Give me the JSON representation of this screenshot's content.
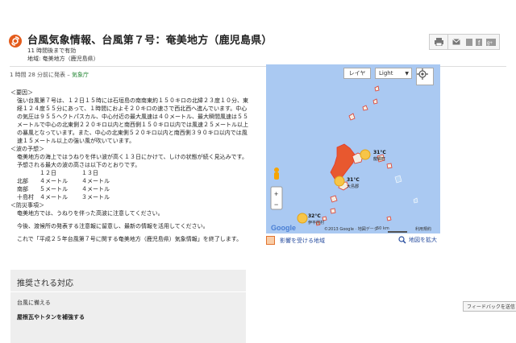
{
  "header": {
    "title": "台風気象情報、台風第７号：奄美地方（鹿児島県）",
    "valid": "11 時間後まで有効",
    "region": "地域: 奄美地方（鹿児島県）"
  },
  "posted": {
    "time": "1 時間 28 分前に発表 – ",
    "source": "気象庁"
  },
  "body": {
    "s1_head": "＜要因＞",
    "s1_text": "強い台風第７号は、１２日１５時には石垣島の南南東約１５０キロの北緯２３度１０分、東経１２４度５５分にあって、１時間におよそ２０キロの速さで西北西へ進んでいます。中心の気圧は９５５ヘクトパスカル、中心付近の最大風速は４０メートル、最大瞬間風速は５５メートルで中心の北東側２２０キロ以内と南西側１５０キロ以内では風速２５メートル以上の暴風となっています。また、中心の北東側５２０キロ以内と南西側３９０キロ以内では風速１５メートル以上の強い風が吹いています。",
    "s2_head": "＜波の予想＞",
    "s2_text": "奄美地方の海上ではうねりを伴い波が高く１３日にかけて、しけの状態が続く見込みです。予想される最大の波の高さは以下のとおりです。",
    "wave_rows": [
      [
        "",
        "１２日",
        "１３日"
      ],
      [
        "北部",
        "４メートル",
        "４メートル"
      ],
      [
        "南部",
        "５メートル",
        "４メートル"
      ],
      [
        "十島村",
        "４メートル",
        "３メートル"
      ]
    ],
    "s3_head": "＜防災事項＞",
    "s3_text": "奄美地方では、うねりを伴った高波に注意してください。",
    "s4_text": "今後、渡候所の発表する注意報に留意し、最新の情報を活用してください。",
    "s5_text": "これで「平成２５年台風第７号に関する奄美地方（鹿児島県）気象情報」を終了します。"
  },
  "recommend": {
    "title": "推奨される対応",
    "t1": "台風に備える",
    "t2": "屋根瓦やトタンを補強する"
  },
  "map": {
    "layer_btn": "レイヤ",
    "layer_select": "Light",
    "labels": [
      {
        "temp": "31°C",
        "place": "龍郷町"
      },
      {
        "temp": "31°C",
        "place": "大島郡"
      },
      {
        "temp": "32°C",
        "place": "伊平屋村"
      }
    ],
    "copyright": "©2013 Google · 地図データ",
    "scale": "50 km",
    "terms": "利用規約"
  },
  "legend": {
    "affected": "影響を受ける地域",
    "enlarge": "地図を拡大"
  },
  "feedback": "フィードバックを送信",
  "colors": {
    "accent": "#e45c1c",
    "link": "#2a4fa0",
    "source": "#2a8a3a",
    "affected_fill": "#f9cda7"
  }
}
